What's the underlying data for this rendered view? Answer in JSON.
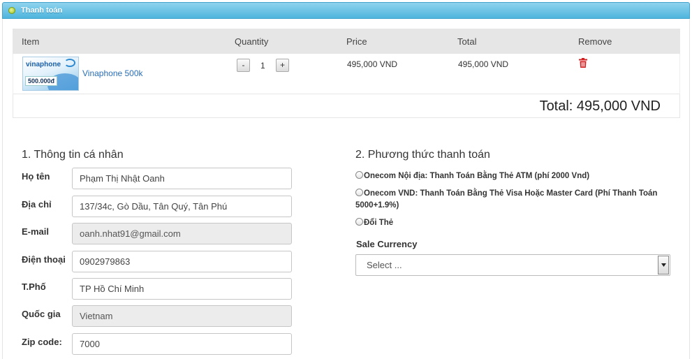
{
  "panel": {
    "title": "Thanh toán"
  },
  "cart": {
    "headers": {
      "item": "Item",
      "quantity": "Quantity",
      "price": "Price",
      "total": "Total",
      "remove": "Remove"
    },
    "items": [
      {
        "name": "Vinaphone 500k",
        "thumb_brand": "vinaphone",
        "thumb_amount": "500.000đ",
        "quantity": "1",
        "price": "495,000 VND",
        "total": "495,000 VND"
      }
    ],
    "minus_label": "-",
    "plus_label": "+",
    "grand_total": "Total: 495,000 VND"
  },
  "personal": {
    "title": "1. Thông tin cá nhân",
    "fields": [
      {
        "label": "Họ tên",
        "value": "Phạm Thị Nhật Oanh",
        "readonly": false
      },
      {
        "label": "Địa chỉ",
        "value": "137/34c, Gò Dầu, Tân Quý, Tân Phú",
        "readonly": false
      },
      {
        "label": "E-mail",
        "value": "oanh.nhat91@gmail.com",
        "readonly": true
      },
      {
        "label": "Điện thoại",
        "value": "0902979863",
        "readonly": false
      },
      {
        "label": "T.Phố",
        "value": "TP Hồ Chí Minh",
        "readonly": false
      },
      {
        "label": "Quốc gia",
        "value": "Vietnam",
        "readonly": true
      },
      {
        "label": "Zip code:",
        "value": "7000",
        "readonly": false
      }
    ]
  },
  "payment": {
    "title": "2. Phương thức thanh toán",
    "options": [
      "Onecom Nội địa: Thanh Toán Bằng Thẻ ATM (phí 2000 Vnd)",
      "Onecom VND: Thanh Toán Bằng Thẻ Visa Hoặc Master Card (Phí Thanh Toán 5000+1.9%)",
      "Đổi Thẻ"
    ],
    "currency_label": "Sale Currency",
    "currency_select": "Select ..."
  },
  "colors": {
    "header_top": "#8fd3ee",
    "header_bottom": "#4fb5dd",
    "link": "#2a6fb8",
    "trash": "#d42020"
  },
  "icons": {
    "header": "status-dot-icon",
    "remove": "trash-icon",
    "select": "chevron-down-icon"
  }
}
